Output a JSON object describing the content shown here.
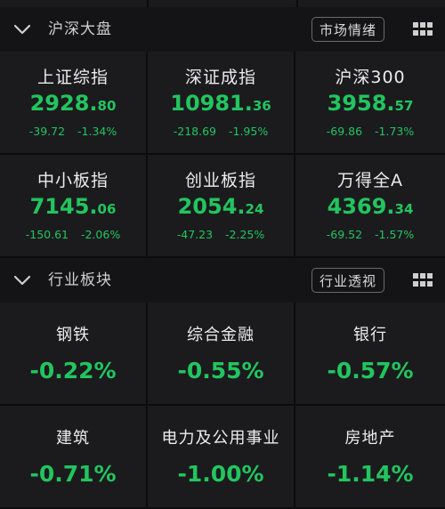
{
  "market": {
    "title": "沪深大盘",
    "button_label": "市场情绪",
    "indices": [
      {
        "name": "上证综指",
        "price_int": "2928.",
        "price_dec": "80",
        "change": "-39.72",
        "change_pct": "-1.34%"
      },
      {
        "name": "深证成指",
        "price_int": "10981.",
        "price_dec": "36",
        "change": "-218.69",
        "change_pct": "-1.95%"
      },
      {
        "name": "沪深300",
        "price_int": "3958.",
        "price_dec": "57",
        "change": "-69.86",
        "change_pct": "-1.73%"
      },
      {
        "name": "中小板指",
        "price_int": "7145.",
        "price_dec": "06",
        "change": "-150.61",
        "change_pct": "-2.06%"
      },
      {
        "name": "创业板指",
        "price_int": "2054.",
        "price_dec": "24",
        "change": "-47.23",
        "change_pct": "-2.25%"
      },
      {
        "name": "万得全A",
        "price_int": "4369.",
        "price_dec": "34",
        "change": "-69.52",
        "change_pct": "-1.57%"
      }
    ]
  },
  "sectors": {
    "title": "行业板块",
    "button_label": "行业透视",
    "items": [
      {
        "name": "钢铁",
        "change_pct": "-0.22%"
      },
      {
        "name": "综合金融",
        "change_pct": "-0.55%"
      },
      {
        "name": "银行",
        "change_pct": "-0.57%"
      },
      {
        "name": "建筑",
        "change_pct": "-0.71%"
      },
      {
        "name": "电力及公用事业",
        "change_pct": "-1.00%"
      },
      {
        "name": "房地产",
        "change_pct": "-1.14%"
      }
    ]
  },
  "icons": {
    "collapse": "chevron-down-icon",
    "grid": "grid-icon"
  },
  "colors": {
    "down": "#22c55e",
    "background": "#0c0c0e",
    "tile": "#1b1b1e",
    "header": "#141416"
  }
}
